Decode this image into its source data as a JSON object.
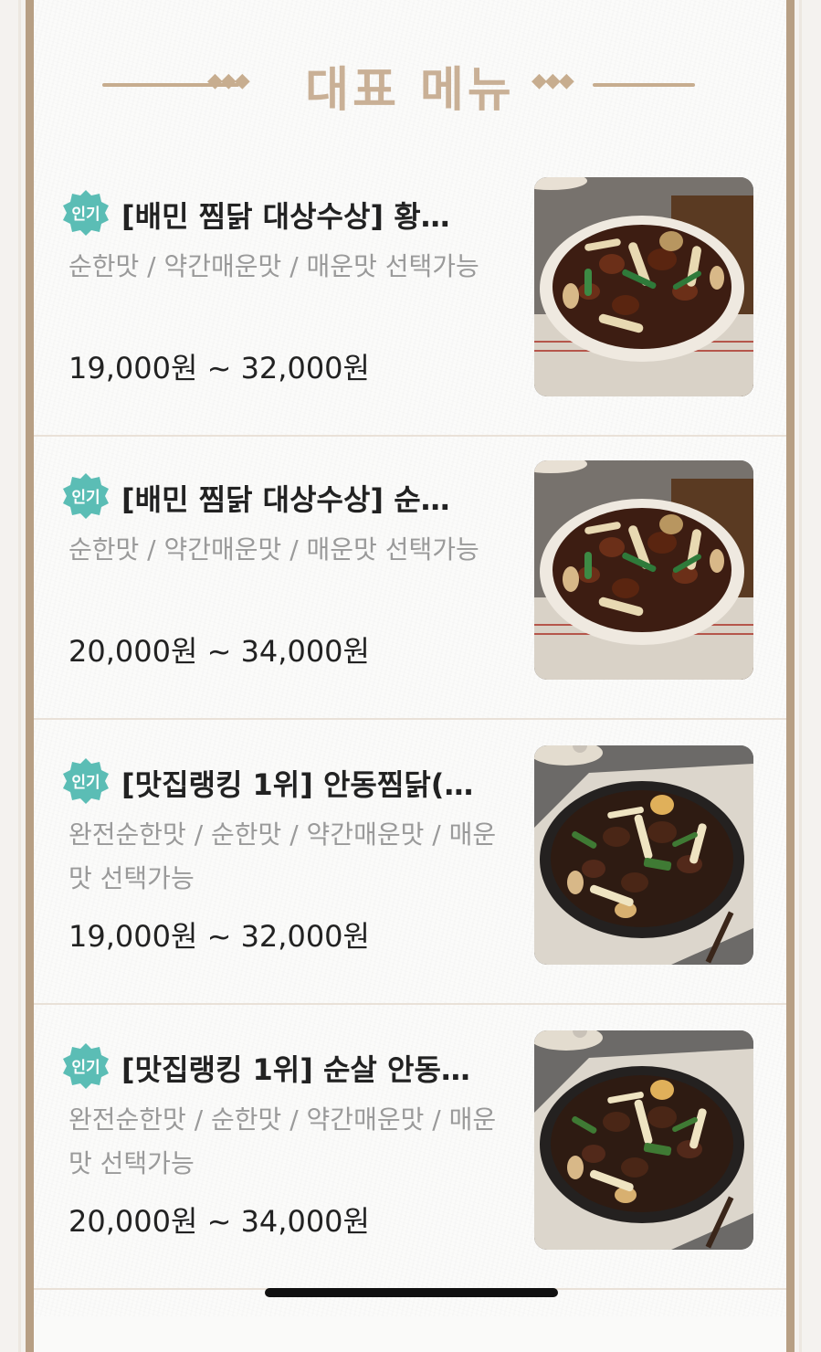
{
  "header": {
    "title": "대표 메뉴",
    "ornament_left": "◆◆◆",
    "ornament_right": "◆◆◆"
  },
  "colors": {
    "frame": "#b79f84",
    "title": "#c9b096",
    "badge": "#5bbdb5",
    "price": "#222222",
    "desc": "#9a9a9a"
  },
  "menu": [
    {
      "badge": "인기",
      "name": "[배민 찜닭 대상수상] 황…",
      "desc": "순한맛 / 약간매운맛 / 매운맛 선택가능",
      "price": "19,000원 ~ 32,000원",
      "image_icon": "jjimdak-dish-image"
    },
    {
      "badge": "인기",
      "name": "[배민 찜닭 대상수상] 순…",
      "desc": "순한맛 / 약간매운맛 / 매운맛 선택가능",
      "price": "20,000원 ~ 34,000원",
      "image_icon": "jjimdak-dish-image"
    },
    {
      "badge": "인기",
      "name": "[맛집랭킹 1위] 안동찜닭(…",
      "desc": "완전순한맛 / 순한맛 / 약간매운맛 / 매운맛 선택가능",
      "price": "19,000원 ~ 32,000원",
      "image_icon": "andong-jjimdak-dish-image"
    },
    {
      "badge": "인기",
      "name": "[맛집랭킹 1위] 순살 안동…",
      "desc": "완전순한맛 / 순한맛 / 약간매운맛 / 매운맛 선택가능",
      "price": "20,000원 ~ 34,000원",
      "image_icon": "andong-jjimdak-dish-image"
    }
  ]
}
